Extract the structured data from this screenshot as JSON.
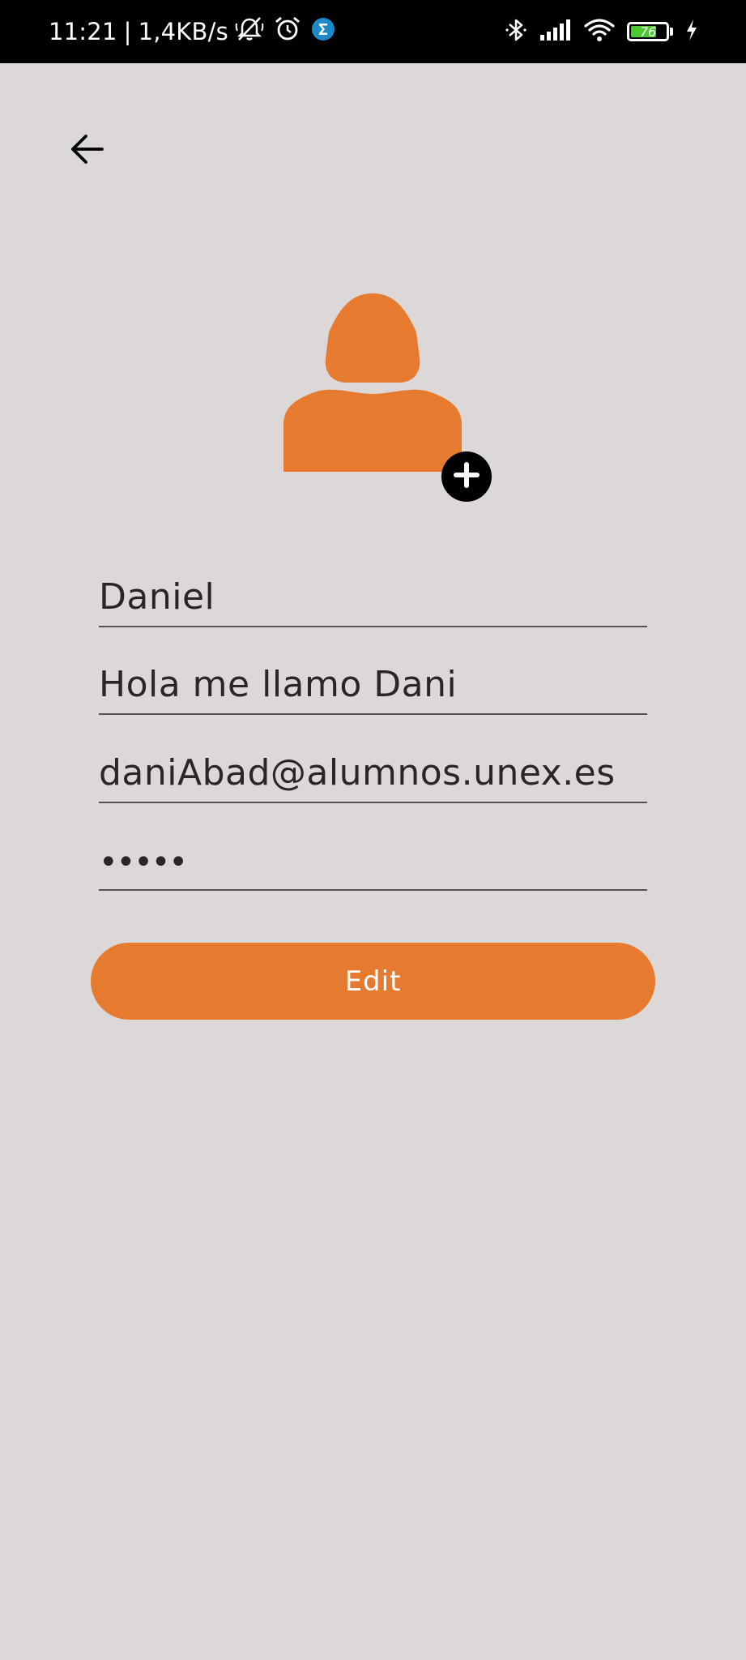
{
  "status_bar": {
    "time": "11:21",
    "separator": "|",
    "network_speed": "1,4KB/s",
    "battery_level": "76",
    "battery_fraction": 0.76,
    "icons_left": [
      "mute-notifications-icon",
      "alarm-icon",
      "sigma-app-icon"
    ],
    "icons_right": [
      "bluetooth-icon",
      "signal-icon",
      "wifi-icon",
      "battery-icon",
      "charging-icon"
    ]
  },
  "header": {
    "back_icon": "arrow-left-icon"
  },
  "avatar": {
    "icon": "user-silhouette-icon",
    "add_icon": "plus-icon",
    "color": "#e67a2e"
  },
  "form": {
    "name_value": "Daniel",
    "description_value": "Hola me llamo Dani",
    "email_value": "daniAbad@alumnos.unex.es",
    "password_value": "•••••"
  },
  "actions": {
    "edit_label": "Edit"
  },
  "colors": {
    "background": "#dcd8d8",
    "accent": "#e67a2e",
    "status_bar": "#000000",
    "field_text": "#2a2628",
    "field_underline": "#55525a"
  }
}
